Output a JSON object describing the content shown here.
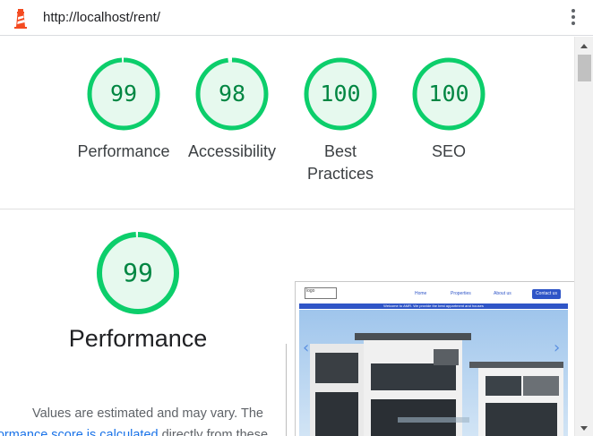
{
  "browser": {
    "url": "http://localhost/rent/",
    "menu_icon": "more-vert-icon",
    "logo_icon": "lighthouse-icon"
  },
  "colors": {
    "pass_green": "#0cce6b",
    "pass_text": "#018642",
    "pass_fill": "#e6f9ee",
    "link_blue": "#1a73e8"
  },
  "summary": {
    "gauges": [
      {
        "score": "99",
        "label": "Performance",
        "fraction": 0.99
      },
      {
        "score": "98",
        "label": "Accessibility",
        "fraction": 0.98
      },
      {
        "score": "100",
        "label_line1": "Best",
        "label_line2": "Practices",
        "fraction": 1.0
      },
      {
        "score": "100",
        "label": "SEO",
        "fraction": 1.0
      }
    ]
  },
  "performance": {
    "score": "99",
    "fraction": 0.99,
    "title": "Performance",
    "desc_line1": "Values are estimated and may vary. The",
    "desc_link": "rformance score is calculated",
    "desc_line2_rest": " directly from these"
  },
  "screenshot": {
    "logo_alt": "logo",
    "nav": [
      "Home",
      "Properties",
      "About us"
    ],
    "contact": "Contact us",
    "banner": "Welcome to AMR. We provide the best appartment and houses"
  }
}
